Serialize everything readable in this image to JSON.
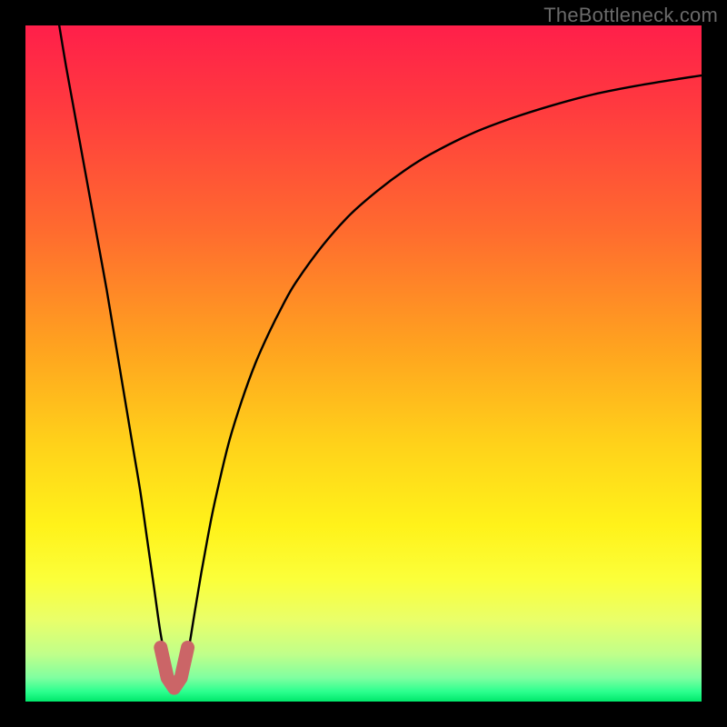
{
  "watermark": {
    "text": "TheBottleneck.com"
  },
  "colors": {
    "frame_bg": "#000000",
    "curve": "#000000",
    "marker": "#cb6567",
    "gradient_stops": [
      {
        "offset": 0.0,
        "color": "#ff1f4a"
      },
      {
        "offset": 0.12,
        "color": "#ff3a3f"
      },
      {
        "offset": 0.3,
        "color": "#ff6a2f"
      },
      {
        "offset": 0.48,
        "color": "#ffa41f"
      },
      {
        "offset": 0.62,
        "color": "#ffd21a"
      },
      {
        "offset": 0.74,
        "color": "#fff21a"
      },
      {
        "offset": 0.82,
        "color": "#fbff3a"
      },
      {
        "offset": 0.88,
        "color": "#e9ff6a"
      },
      {
        "offset": 0.93,
        "color": "#c0ff8a"
      },
      {
        "offset": 0.965,
        "color": "#7fffa0"
      },
      {
        "offset": 0.985,
        "color": "#2dff8f"
      },
      {
        "offset": 1.0,
        "color": "#00e86b"
      }
    ]
  },
  "chart_data": {
    "type": "line",
    "title": "",
    "xlabel": "",
    "ylabel": "",
    "xlim": [
      0,
      100
    ],
    "ylim": [
      0,
      100
    ],
    "optimum_x": 22,
    "series": [
      {
        "name": "bottleneck-curve",
        "x": [
          5,
          6,
          7,
          8,
          9,
          10,
          11,
          12,
          13,
          14,
          15,
          16,
          17,
          18,
          19,
          20,
          21,
          22,
          23,
          24,
          25,
          26,
          27,
          28,
          30,
          32,
          34,
          36,
          38,
          40,
          44,
          48,
          52,
          56,
          60,
          66,
          72,
          78,
          84,
          90,
          96,
          100
        ],
        "y": [
          100,
          94,
          88.5,
          83,
          77.5,
          72,
          66.5,
          61,
          55,
          49,
          43,
          37,
          31,
          24,
          17,
          10,
          5,
          2,
          3,
          7,
          13,
          19,
          24.5,
          29.5,
          38,
          44.5,
          50,
          54.5,
          58.5,
          62,
          67.5,
          72,
          75.5,
          78.5,
          81,
          84,
          86.3,
          88.2,
          89.8,
          91,
          92,
          92.6
        ]
      }
    ],
    "marker": {
      "name": "optimum-band",
      "shape": "u",
      "x": [
        20,
        21,
        22,
        23,
        24
      ],
      "y": [
        8,
        3.5,
        2,
        3.5,
        8
      ]
    }
  }
}
